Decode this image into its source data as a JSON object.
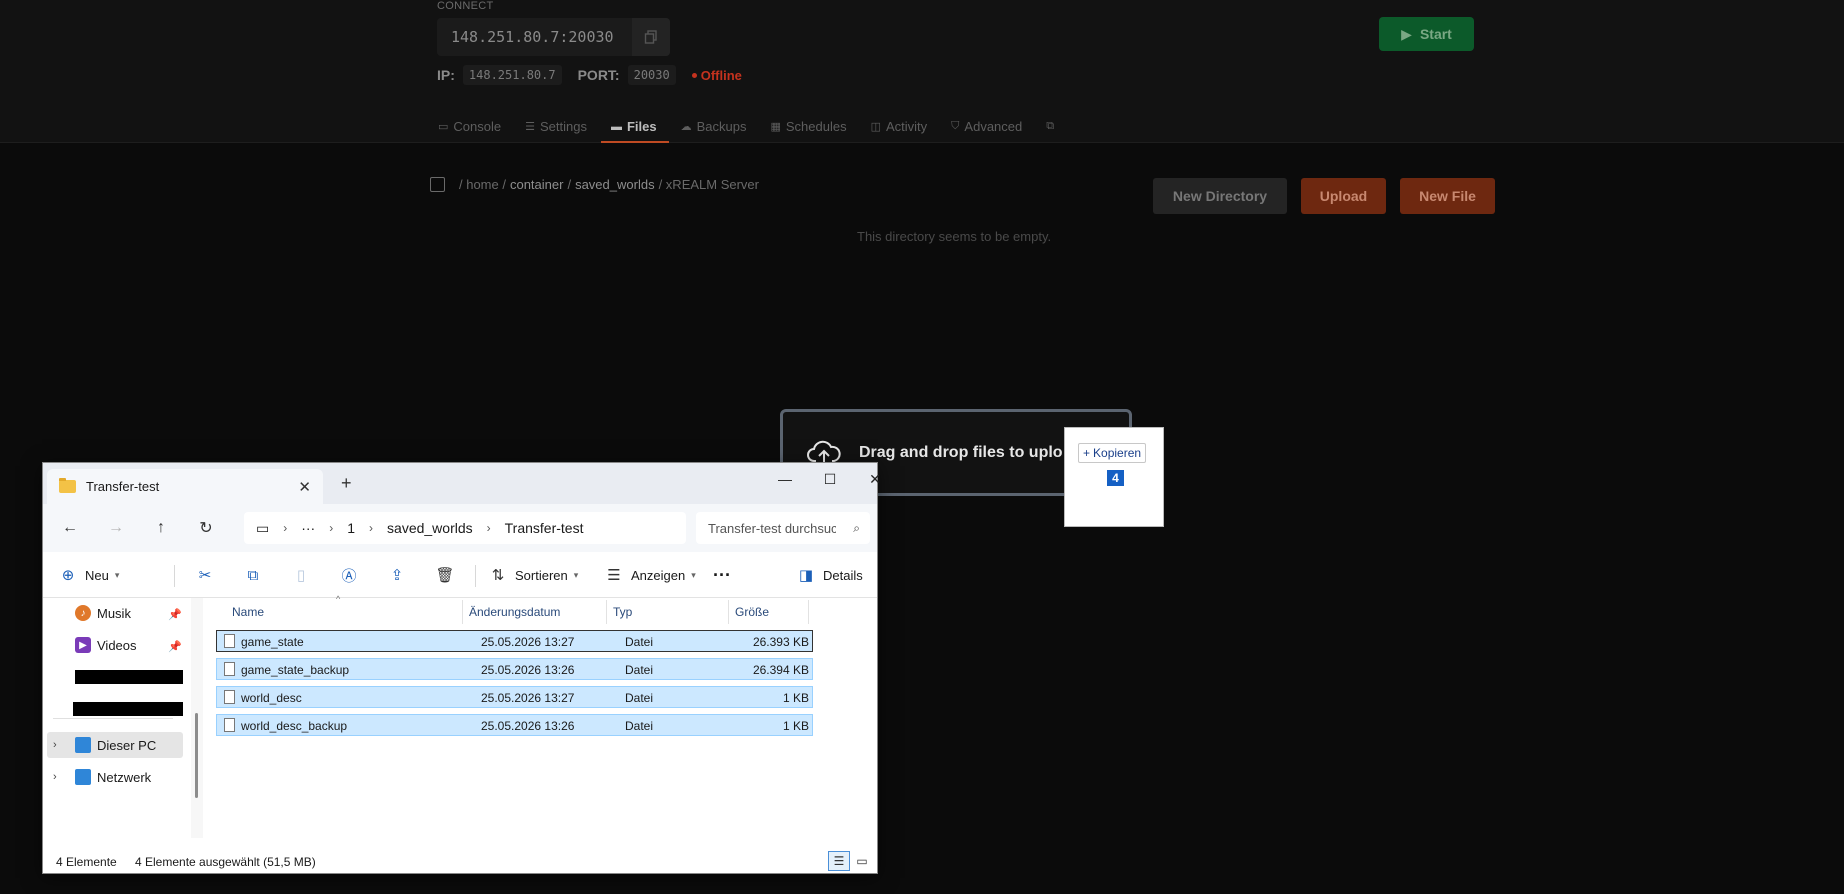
{
  "panel": {
    "connect_label": "CONNECT",
    "address": "148.251.80.7:20030",
    "ip_label": "IP:",
    "ip_value": "148.251.80.7",
    "port_label": "PORT:",
    "port_value": "20030",
    "status": "Offline",
    "start_label": "Start",
    "tabs": [
      {
        "label": "Console",
        "icon": "console-icon"
      },
      {
        "label": "Settings",
        "icon": "sliders-icon"
      },
      {
        "label": "Files",
        "icon": "folder-icon"
      },
      {
        "label": "Backups",
        "icon": "cloud-icon"
      },
      {
        "label": "Schedules",
        "icon": "calendar-icon"
      },
      {
        "label": "Activity",
        "icon": "activity-icon"
      },
      {
        "label": "Advanced",
        "icon": "shield-icon"
      }
    ],
    "active_tab": "Files",
    "breadcrumb": [
      "/ home /",
      "container",
      "/",
      "saved_worlds",
      "/ xREALM Server"
    ],
    "new_directory_label": "New Directory",
    "upload_label": "Upload",
    "new_file_label": "New File",
    "empty_message": "This directory seems to be empty.",
    "drop_text": "Drag and drop files to uplo",
    "drag_tip_action": "Kopieren",
    "drag_tip_count": "4",
    "colors": {
      "accent": "#c04b23",
      "start": "#0c5a2a",
      "offline": "#c4321e"
    }
  },
  "explorer": {
    "tab_title": "Transfer-test",
    "path": [
      "1",
      "saved_worlds",
      "Transfer-test"
    ],
    "path_ellipsis": "···",
    "search_placeholder": "Transfer-test durchsuchen",
    "commands": {
      "new_label": "Neu",
      "sort_label": "Sortieren",
      "view_label": "Anzeigen",
      "more_label": "···",
      "details_label": "Details"
    },
    "nav": {
      "musik": "Musik",
      "videos": "Videos",
      "dieser_pc": "Dieser PC",
      "netzwerk": "Netzwerk"
    },
    "columns": [
      "Name",
      "Änderungsdatum",
      "Typ",
      "Größe"
    ],
    "files": [
      {
        "name": "game_state",
        "date": "25.05.2026 13:27",
        "type": "Datei",
        "size": "26.393 KB"
      },
      {
        "name": "game_state_backup",
        "date": "25.05.2026 13:26",
        "type": "Datei",
        "size": "26.394 KB"
      },
      {
        "name": "world_desc",
        "date": "25.05.2026 13:27",
        "type": "Datei",
        "size": "1 KB"
      },
      {
        "name": "world_desc_backup",
        "date": "25.05.2026 13:26",
        "type": "Datei",
        "size": "1 KB"
      }
    ],
    "status_count": "4 Elemente",
    "status_selected": "4 Elemente ausgewählt (51,5 MB)"
  }
}
